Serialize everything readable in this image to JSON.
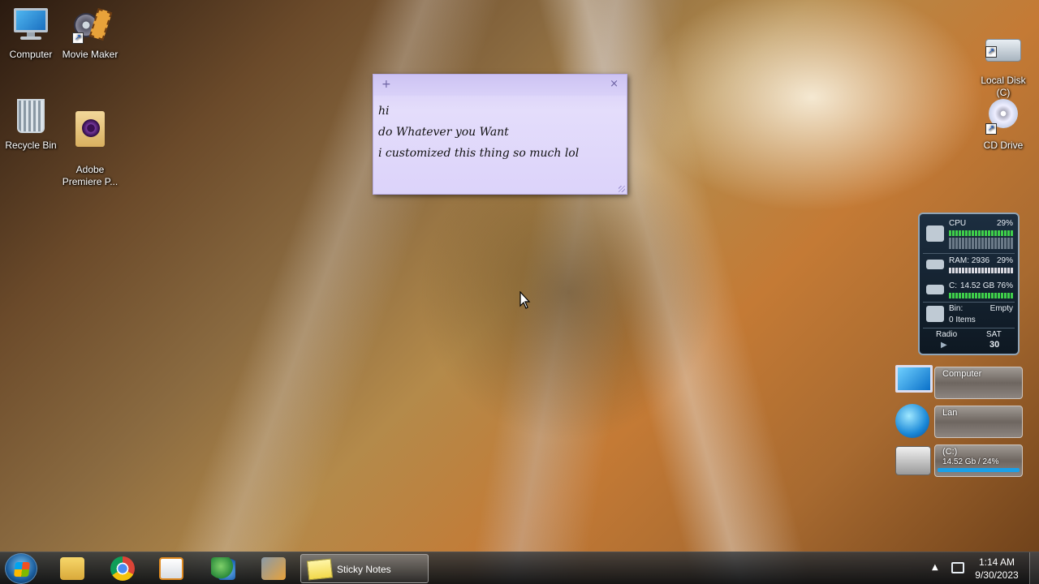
{
  "desktop_icons": {
    "computer": "Computer",
    "movie_maker": "Movie Maker",
    "recycle_bin": "Recycle Bin",
    "premiere": "Adobe\nPremiere P...",
    "local_disk": "Local Disk\n(C)",
    "cd_drive": "CD Drive"
  },
  "sticky_note": {
    "add_symbol": "+",
    "close_symbol": "×",
    "lines": [
      "hi",
      "do Whatever you Want",
      "i customized this thing so much lol"
    ]
  },
  "system_monitor": {
    "cpu_label": "CPU",
    "cpu_value": "29%",
    "ram_label": "RAM: 2936",
    "ram_value": "29%",
    "disk_label": "C:",
    "disk_value": "14.52 GB 76%",
    "bin_label": "Bin:",
    "bin_status": "Empty",
    "bin_items": "0 Items",
    "radio_label": "Radio",
    "play_symbol": "▶",
    "day": "SAT",
    "date": "30"
  },
  "drive_gadgets": {
    "computer": "Computer",
    "lan": "Lan",
    "drive_name": "(C:)",
    "drive_usage": "14.52 Gb / 24%"
  },
  "taskbar": {
    "active_window": "Sticky Notes",
    "time": "1:14 AM",
    "date": "9/30/2023",
    "tray_arrow": "▲"
  }
}
